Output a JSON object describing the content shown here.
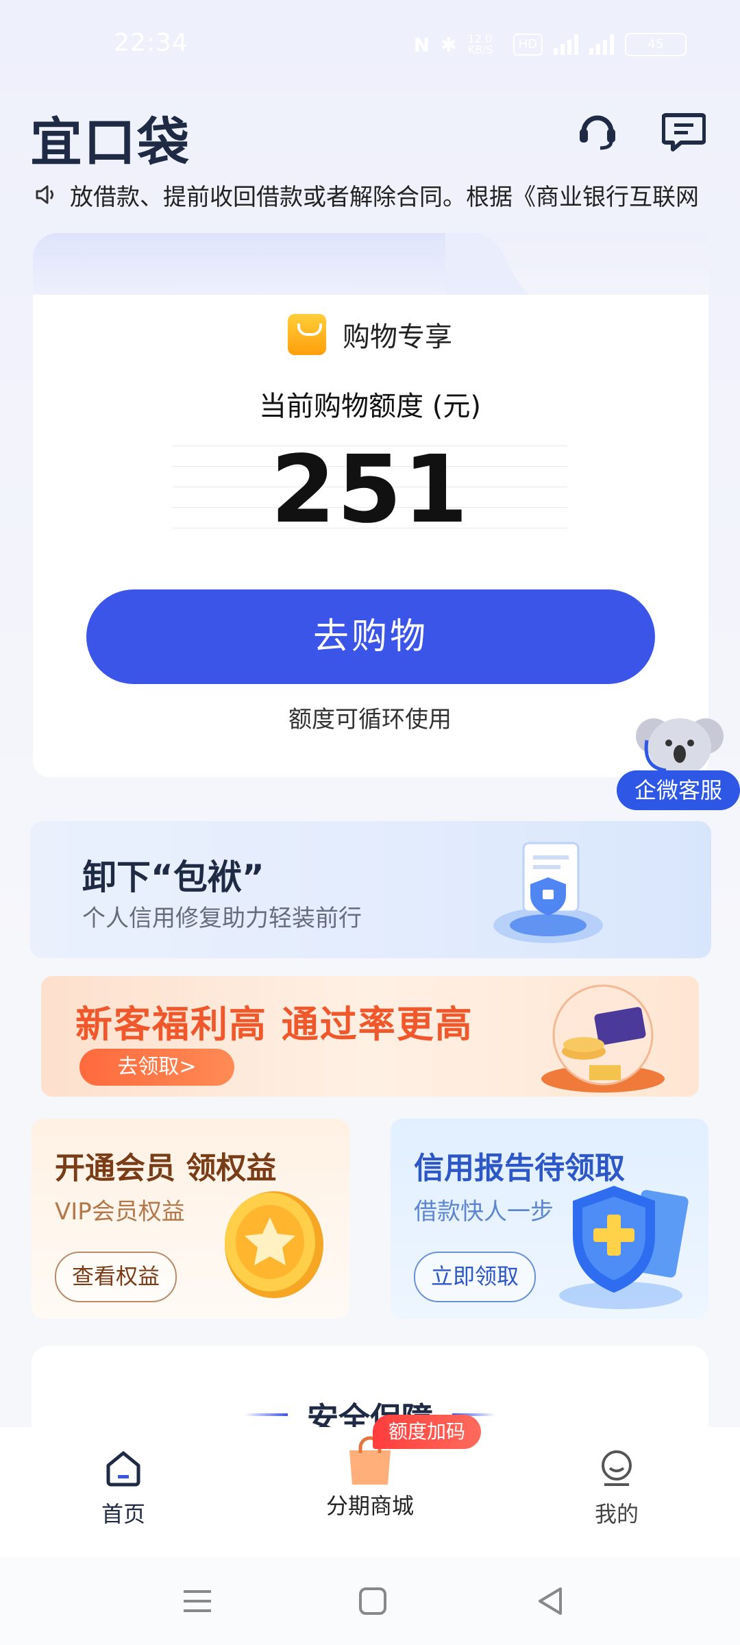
{
  "status_bar": {
    "time": "22:34",
    "net_speed": "12.0 KB/S",
    "hd": "HD",
    "sig1": "5G",
    "sig2": "5G",
    "battery": "45"
  },
  "header": {
    "logo": "宜口袋"
  },
  "notice": {
    "text": "放借款、提前收回借款或者解除合同。根据《商业银行互联网"
  },
  "card": {
    "tag": "购物专享",
    "limit_label": "当前购物额度 (元)",
    "amount": "251",
    "button": "去购物",
    "note": "额度可循环使用"
  },
  "customer_service": {
    "label": "企微客服"
  },
  "banner1": {
    "title": "卸下“包袱”",
    "subtitle": "个人信用修复助力轻装前行"
  },
  "banner2": {
    "title": "新客福利高 通过率更高",
    "button": "去领取>"
  },
  "vip_card": {
    "title": "开通会员 领权益",
    "subtitle": "VIP会员权益",
    "button": "查看权益"
  },
  "credit_card": {
    "title": "信用报告待领取",
    "subtitle": "借款快人一步",
    "button": "立即领取"
  },
  "safety": {
    "title": "安全保障"
  },
  "tabbar": {
    "home": "首页",
    "mall": "分期商城",
    "mall_badge": "额度加码",
    "me": "我的"
  },
  "colors": {
    "primary": "#3a55e8",
    "accent_orange": "#f0582c",
    "badge_red": "#ff3d3d"
  }
}
